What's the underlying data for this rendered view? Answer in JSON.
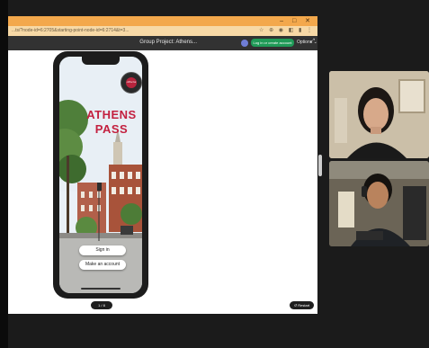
{
  "browser": {
    "window_controls": [
      "–",
      "□",
      "✕"
    ],
    "url": "...ts/?node-id=6:2705&starting-point-node-id=6:2714&t=3...",
    "address_icons": "☆ ⊕ ◉ ◧ ▮ ⋮"
  },
  "app_bar": {
    "title": "Group Project: Athens...",
    "avatar_initial": "",
    "login_button": "Log in or create account",
    "options_label": "Options ⌄",
    "expand_icon": "⤢"
  },
  "prototype": {
    "brand_line1": "ATHENS",
    "brand_line2": "PASS",
    "logo_text": "Athens",
    "sign_in_button": "Sign in",
    "make_account_button": "Make an account"
  },
  "footer": {
    "pager": "1 / 8",
    "restart_button": "↺ Restart"
  },
  "colors": {
    "brand_red": "#c3203f",
    "chrome_orange": "#f3a84c",
    "login_green": "#1f9a57"
  }
}
